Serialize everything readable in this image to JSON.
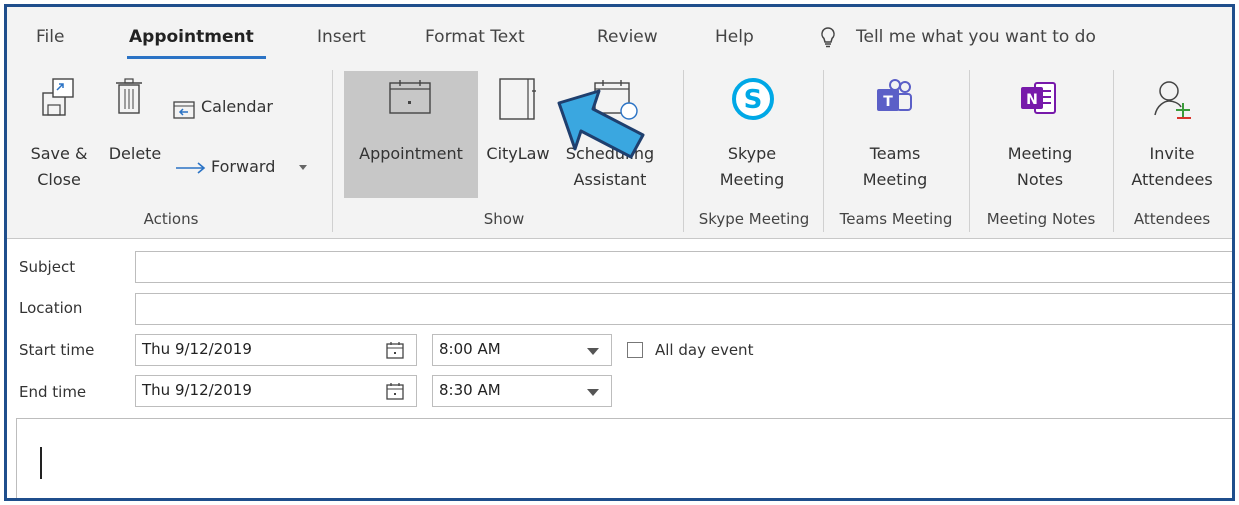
{
  "tabs": {
    "file": "File",
    "appointment": "Appointment",
    "insert": "Insert",
    "format_text": "Format Text",
    "review": "Review",
    "help": "Help",
    "tell_me": "Tell me what you want to do"
  },
  "ribbon": {
    "save_close": [
      "Save &",
      "Close"
    ],
    "delete": "Delete",
    "calendar": "Calendar",
    "forward": "Forward",
    "appointment": "Appointment",
    "citylaw": "CityLaw",
    "scheduling": [
      "Scheduling",
      "Assistant"
    ],
    "skype": [
      "Skype",
      "Meeting"
    ],
    "teams": [
      "Teams",
      "Meeting"
    ],
    "meeting_notes": [
      "Meeting",
      "Notes"
    ],
    "invite": [
      "Invite",
      "Attendees"
    ],
    "groups": {
      "actions": "Actions",
      "show": "Show",
      "skype_meeting": "Skype Meeting",
      "teams_meeting": "Teams Meeting",
      "meeting_notes": "Meeting Notes",
      "attendees": "Attendees"
    }
  },
  "form": {
    "subject_label": "Subject",
    "location_label": "Location",
    "start_label": "Start time",
    "end_label": "End time",
    "subject_value": "",
    "location_value": "",
    "start_date": "Thu 9/12/2019",
    "start_time": "8:00 AM",
    "end_date": "Thu 9/12/2019",
    "end_time": "8:30 AM",
    "all_day_label": "All day event",
    "all_day_checked": false
  },
  "colors": {
    "accent": "#2b73c5",
    "frame": "#1f4e8c",
    "arrow": "#3aa7e0",
    "skype": "#00a8e6",
    "teams": "#5b5fc7",
    "onenote": "#7719aa"
  }
}
